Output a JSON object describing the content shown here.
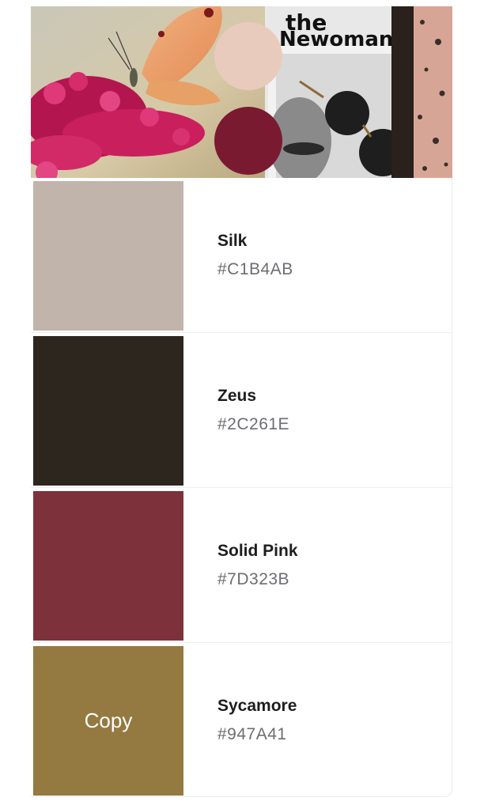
{
  "hero": {
    "magazine_title_line1": "the",
    "magazine_title_line2": "Newoman",
    "circles": [
      {
        "name": "blush",
        "color": "#E9CBBE"
      },
      {
        "name": "wine",
        "color": "#7A1A30"
      }
    ]
  },
  "palette": [
    {
      "name": "Silk",
      "hex": "#C1B4AB",
      "copy_label": ""
    },
    {
      "name": "Zeus",
      "hex": "#2C261E",
      "copy_label": ""
    },
    {
      "name": "Solid Pink",
      "hex": "#7D323B",
      "copy_label": ""
    },
    {
      "name": "Sycamore",
      "hex": "#947A41",
      "copy_label": "Copy"
    }
  ]
}
